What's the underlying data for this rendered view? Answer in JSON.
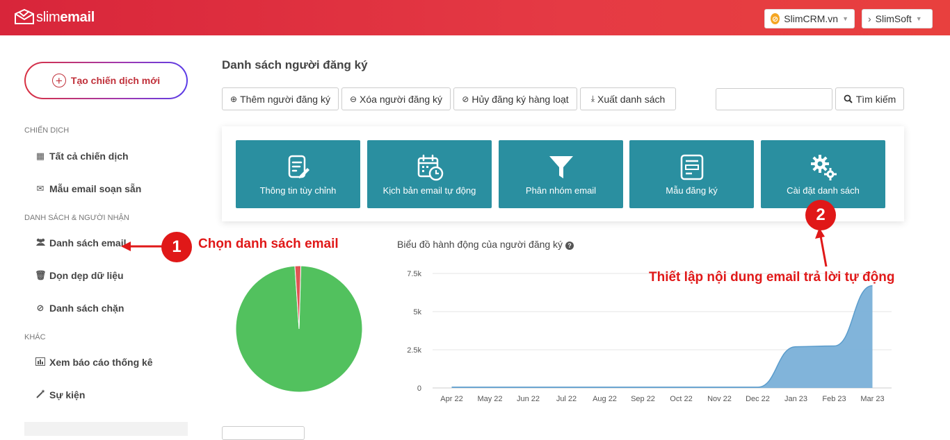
{
  "header": {
    "logo_slim": "slim",
    "logo_email": "email",
    "crm_button": "SlimCRM.vn",
    "soft_button": "SlimSoft",
    "brand_colors": [
      "#d8253a",
      "#e8403e"
    ]
  },
  "sidebar": {
    "create_button": "Tạo chiến dịch mới",
    "sections": {
      "campaigns": "CHIẾN DỊCH",
      "lists": "DANH SÁCH & NGƯỜI NHẬN",
      "other": "KHÁC"
    },
    "items": [
      {
        "label": "Tất cả chiến dịch",
        "icon": "grid-icon"
      },
      {
        "label": "Mẫu email soạn sẵn",
        "icon": "envelope-icon"
      },
      {
        "label": "Danh sách email",
        "icon": "users-icon"
      },
      {
        "label": "Dọn dẹp dữ liệu",
        "icon": "trash-icon"
      },
      {
        "label": "Danh sách chặn",
        "icon": "ban-icon"
      },
      {
        "label": "Xem báo cáo thống kê",
        "icon": "bar-chart-icon"
      },
      {
        "label": "Sự kiện",
        "icon": "magic-wand-icon"
      }
    ]
  },
  "main": {
    "title": "Danh sách người đăng ký",
    "toolbar": {
      "add": "Thêm người đăng ký",
      "remove": "Xóa người đăng ký",
      "unsubscribe": "Hủy đăng ký hàng loạt",
      "export": "Xuất danh sách",
      "search": "Tìm kiếm",
      "search_value": ""
    },
    "tiles": [
      {
        "label": "Thông tin tùy chỉnh",
        "icon": "edit-document-icon"
      },
      {
        "label": "Kịch bản email tự động",
        "icon": "calendar-clock-icon"
      },
      {
        "label": "Phân nhóm email",
        "icon": "funnel-icon"
      },
      {
        "label": "Mẫu đăng ký",
        "icon": "form-icon"
      },
      {
        "label": "Cài đặt danh sách",
        "icon": "gears-icon"
      }
    ],
    "tile_color": "#2a8fa0",
    "chart_title": "Biểu đồ hành động của người đăng ký"
  },
  "annotations": {
    "step1_number": "1",
    "step1_text": "Chọn danh sách email",
    "step2_number": "2",
    "step2_text": "Thiết lập nội dung email trả lời tự động",
    "color": "#e01818"
  },
  "chart_data": [
    {
      "type": "pie",
      "values": [
        98.5,
        1.5
      ],
      "colors": [
        "#52c15e",
        "#e05454"
      ]
    },
    {
      "type": "area",
      "title": "Biểu đồ hành động của người đăng ký",
      "categories": [
        "Apr 22",
        "May 22",
        "Jun 22",
        "Jul 22",
        "Aug 22",
        "Sep 22",
        "Oct 22",
        "Nov 22",
        "Dec 22",
        "Jan 23",
        "Feb 23",
        "Mar 23"
      ],
      "values": [
        50,
        50,
        50,
        50,
        50,
        50,
        50,
        50,
        50,
        2700,
        2750,
        6700
      ],
      "yticks": [
        "0",
        "2.5k",
        "5k",
        "7.5k"
      ],
      "ylim": [
        0,
        7500
      ],
      "grid": true,
      "color": "#7ab0d8"
    }
  ]
}
